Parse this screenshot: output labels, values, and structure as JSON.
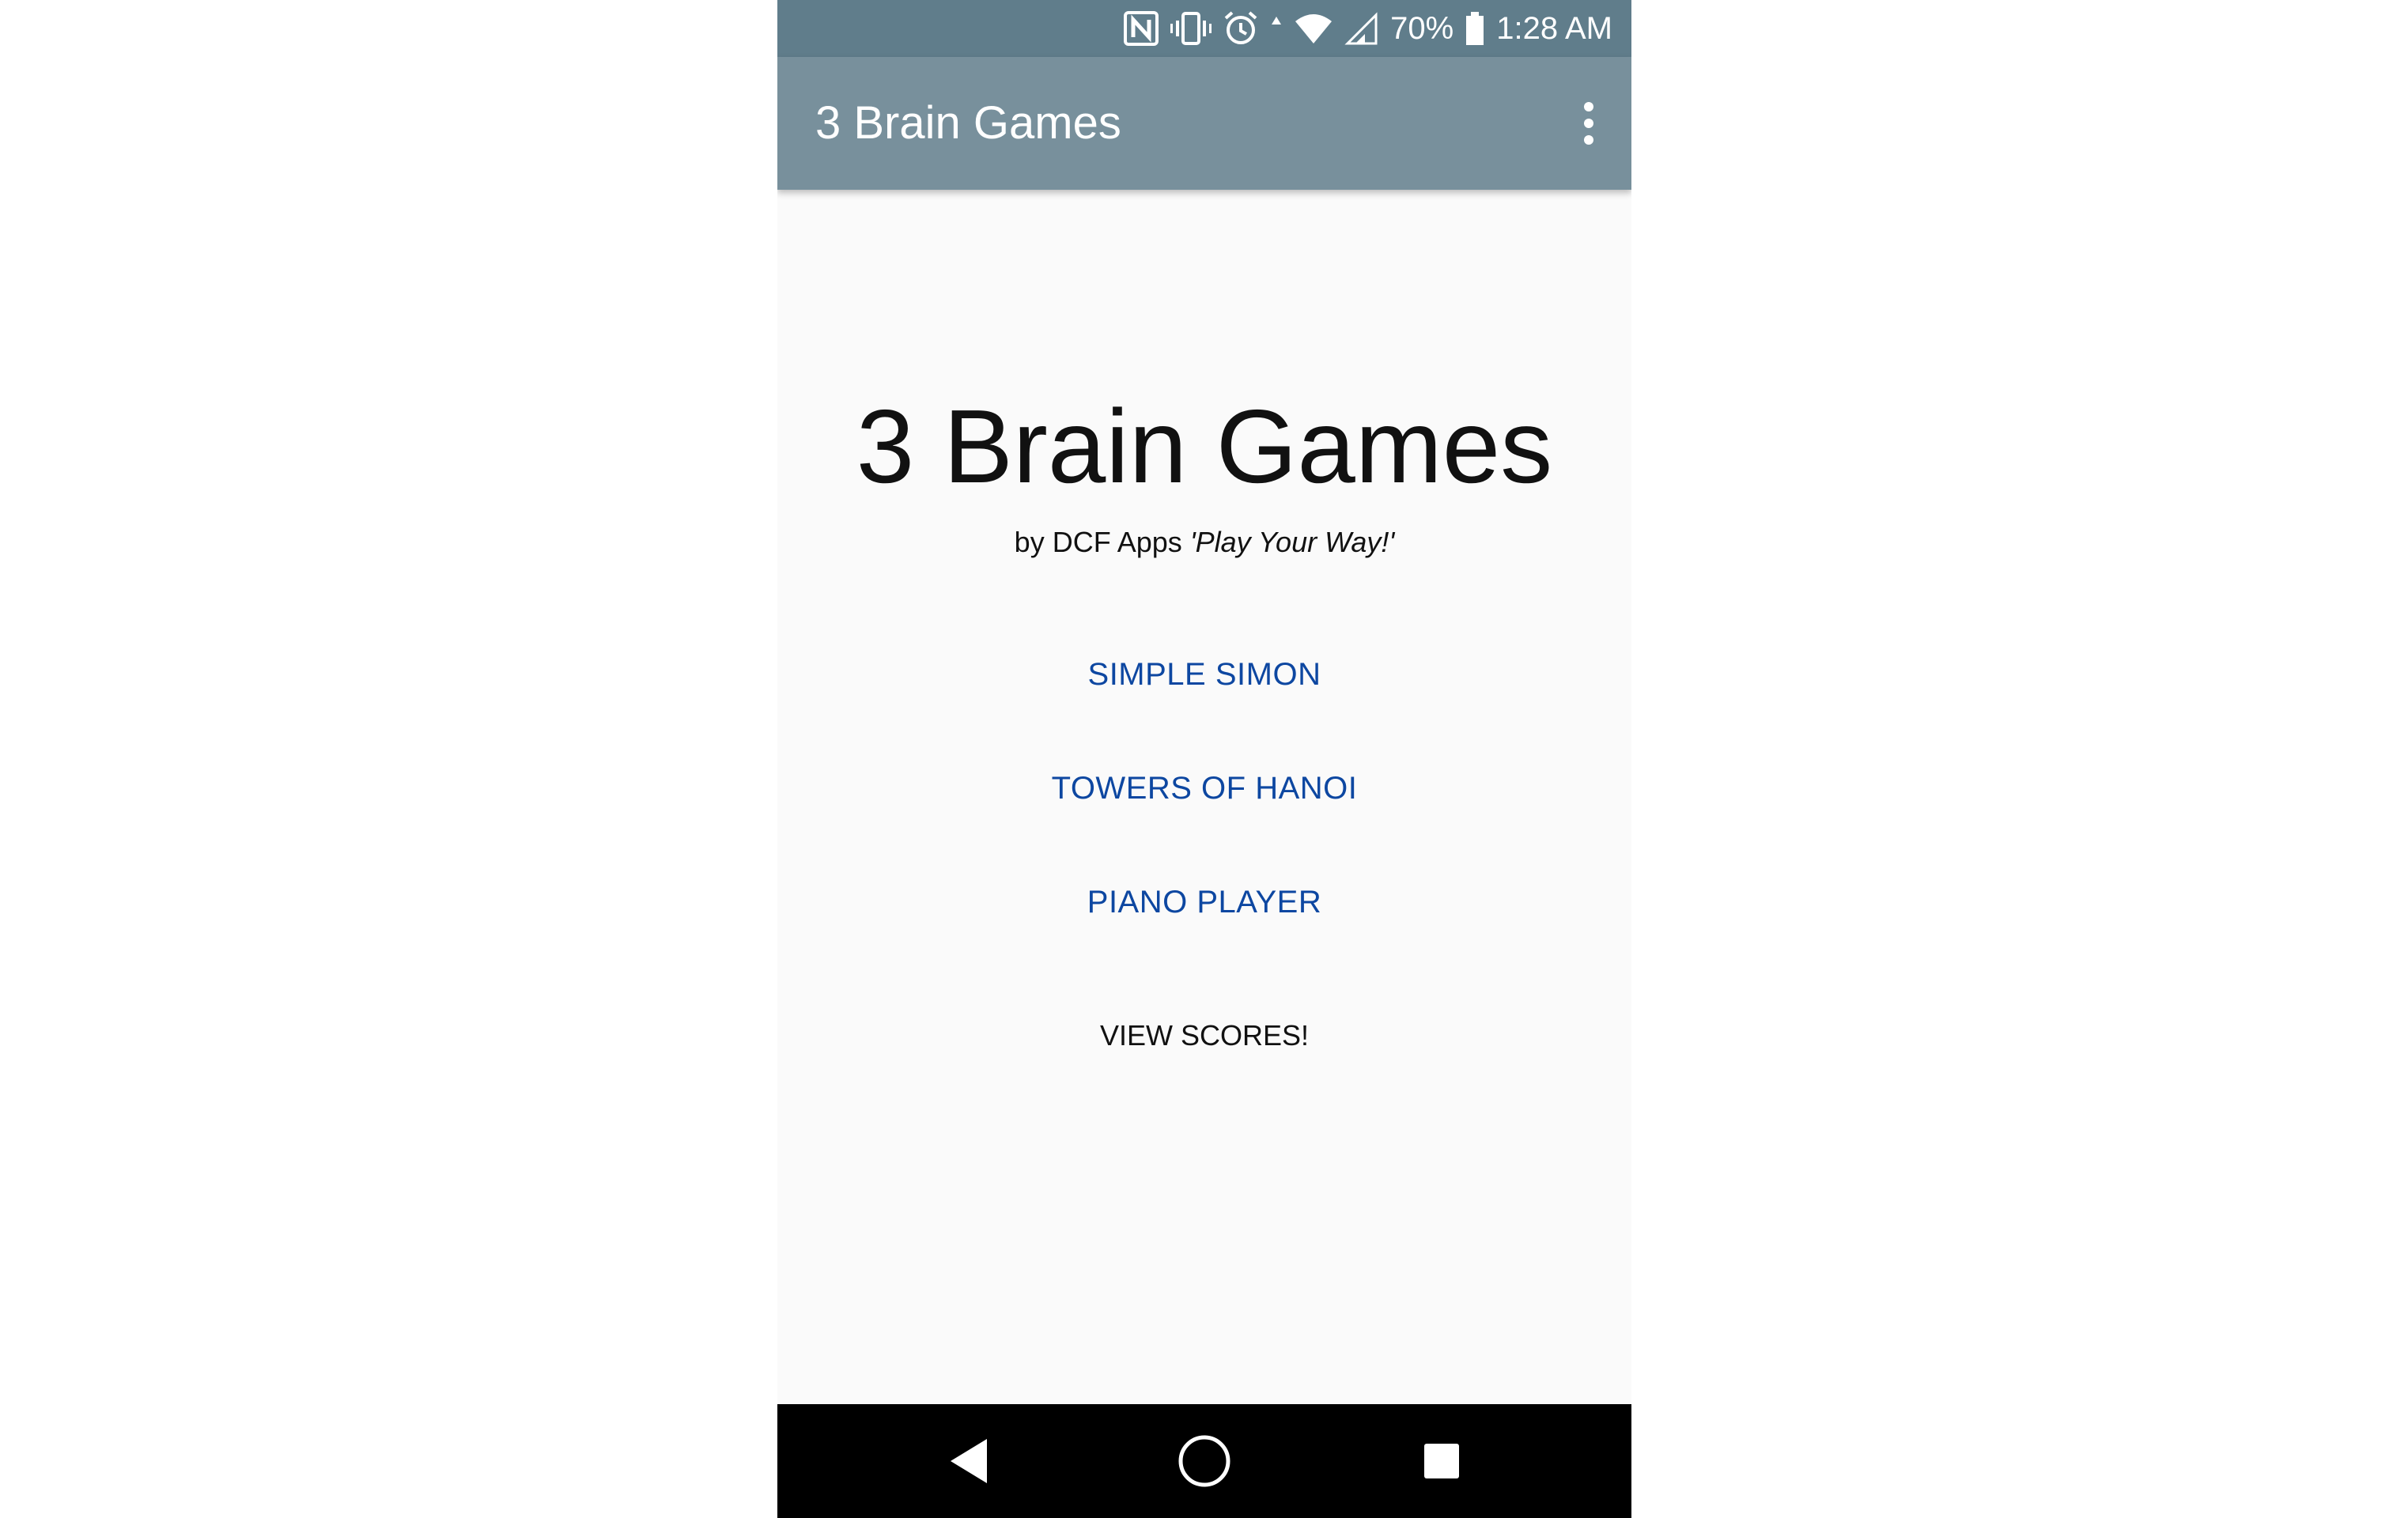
{
  "status_bar": {
    "battery_percent": "70%",
    "time": "1:28 AM",
    "icons": [
      "nfc-icon",
      "vibrate-icon",
      "alarm-icon",
      "data-arrows-icon",
      "wifi-icon",
      "signal-icon",
      "battery-icon"
    ]
  },
  "app_bar": {
    "title": "3 Brain Games",
    "menu_icon": "more-vert-icon"
  },
  "main": {
    "hero_title": "3 Brain Games",
    "byline": "by DCF Apps ",
    "tagline": "'Play Your Way!'",
    "buttons": [
      {
        "label": "SIMPLE SIMON"
      },
      {
        "label": "TOWERS OF HANOI"
      },
      {
        "label": "PIANO PLAYER"
      }
    ],
    "scores_label": "VIEW SCORES!"
  },
  "nav_bar": {
    "icons": [
      "back-icon",
      "home-icon",
      "recents-icon"
    ]
  },
  "colors": {
    "status_bar": "#607d8b",
    "app_bar": "#78909c",
    "button_text": "#0d47a1",
    "background": "#fafafa"
  }
}
